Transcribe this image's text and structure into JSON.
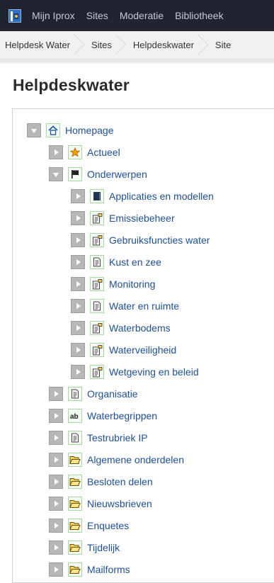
{
  "topbar": {
    "nav": [
      "Mijn Iprox",
      "Sites",
      "Moderatie",
      "Bibliotheek"
    ]
  },
  "breadcrumb": [
    "Helpdesk Water",
    "Sites",
    "Helpdeskwater",
    "Site"
  ],
  "page": {
    "title": "Helpdeskwater"
  },
  "tree": [
    {
      "label": "Homepage",
      "icon": "home-icon",
      "state": "expanded"
    },
    {
      "label": "Actueel",
      "icon": "star-icon",
      "state": "collapsed"
    },
    {
      "label": "Onderwerpen",
      "icon": "flag-icon",
      "state": "expanded"
    },
    {
      "label": "Applicaties en modellen",
      "icon": "book-icon",
      "state": "collapsed"
    },
    {
      "label": "Emissiebeheer",
      "icon": "page-stack-icon",
      "state": "collapsed"
    },
    {
      "label": "Gebruiksfuncties water",
      "icon": "page-stack-icon",
      "state": "collapsed"
    },
    {
      "label": "Kust en zee",
      "icon": "page-icon",
      "state": "collapsed"
    },
    {
      "label": "Monitoring",
      "icon": "page-stack-icon",
      "state": "collapsed"
    },
    {
      "label": "Water en ruimte",
      "icon": "page-icon",
      "state": "collapsed"
    },
    {
      "label": "Waterbodems",
      "icon": "page-stack-icon",
      "state": "collapsed"
    },
    {
      "label": "Waterveiligheid",
      "icon": "page-stack-icon",
      "state": "collapsed"
    },
    {
      "label": "Wetgeving en beleid",
      "icon": "page-stack-icon",
      "state": "collapsed"
    },
    {
      "label": "Organisatie",
      "icon": "page-icon",
      "state": "collapsed"
    },
    {
      "label": "Waterbegrippen",
      "icon": "glossary-ab-icon",
      "state": "collapsed"
    },
    {
      "label": "Testrubriek IP",
      "icon": "page-plain-icon",
      "state": "collapsed"
    },
    {
      "label": "Algemene onderdelen",
      "icon": "folder-icon",
      "state": "collapsed"
    },
    {
      "label": "Besloten delen",
      "icon": "folder-icon",
      "state": "collapsed"
    },
    {
      "label": "Nieuwsbrieven",
      "icon": "folder-icon",
      "state": "collapsed"
    },
    {
      "label": "Enquetes",
      "icon": "folder-icon",
      "state": "collapsed"
    },
    {
      "label": "Tijdelijk",
      "icon": "folder-icon",
      "state": "collapsed"
    },
    {
      "label": "Mailforms",
      "icon": "folder-icon",
      "state": "collapsed"
    }
  ],
  "colors": {
    "topbar_bg": "#1f2430",
    "link": "#1e4f9c",
    "icon_frame": "#a9d6a2",
    "toggle": "#b7b7b7"
  }
}
